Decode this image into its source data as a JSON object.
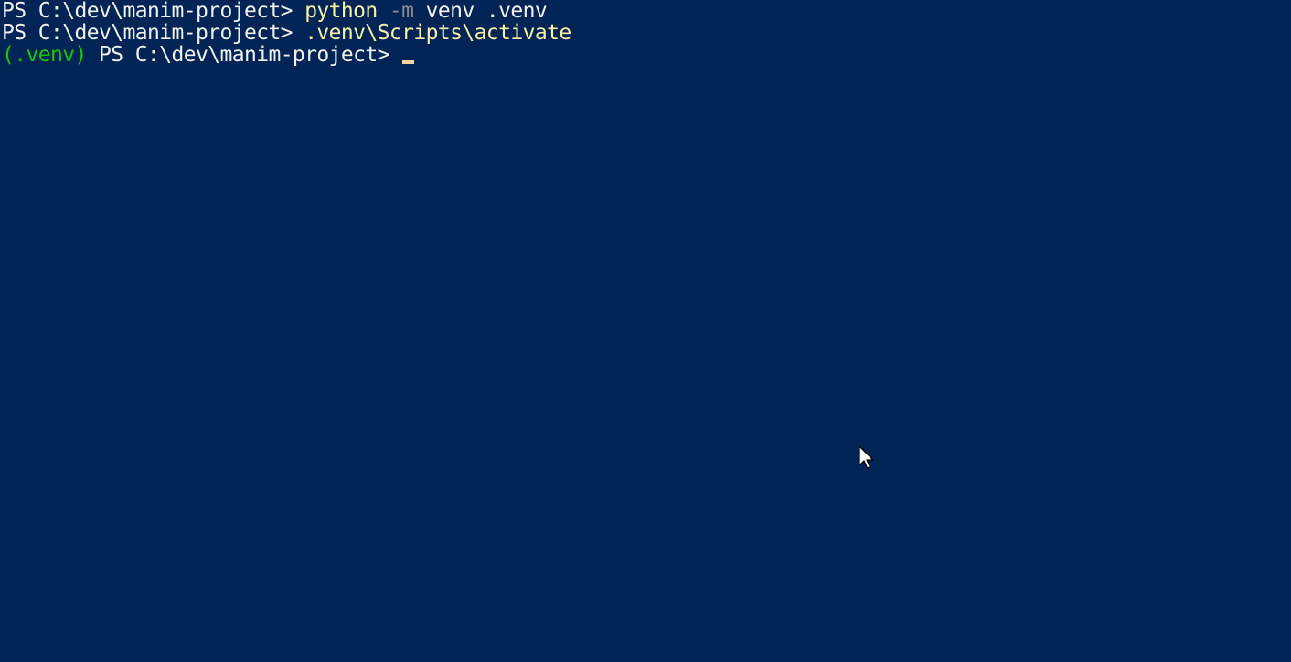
{
  "terminal": {
    "background": "#012456",
    "lines": [
      {
        "prompt": "PS C:\\dev\\manim-project> ",
        "command": "python",
        "param": " -m",
        "args": " venv .venv"
      },
      {
        "prompt": "PS C:\\dev\\manim-project> ",
        "command": ".venv\\Scripts\\activate"
      },
      {
        "venv": "(.venv)",
        "prompt": " PS C:\\dev\\manim-project> "
      }
    ]
  },
  "colors": {
    "prompt": "#f2f2f2",
    "command": "#f9f1a5",
    "parameter": "#8a8a8a",
    "venv_tag": "#16c60c",
    "cursor": "#f9d3a0"
  },
  "icons": {
    "pointer": "mouse-pointer-icon"
  }
}
